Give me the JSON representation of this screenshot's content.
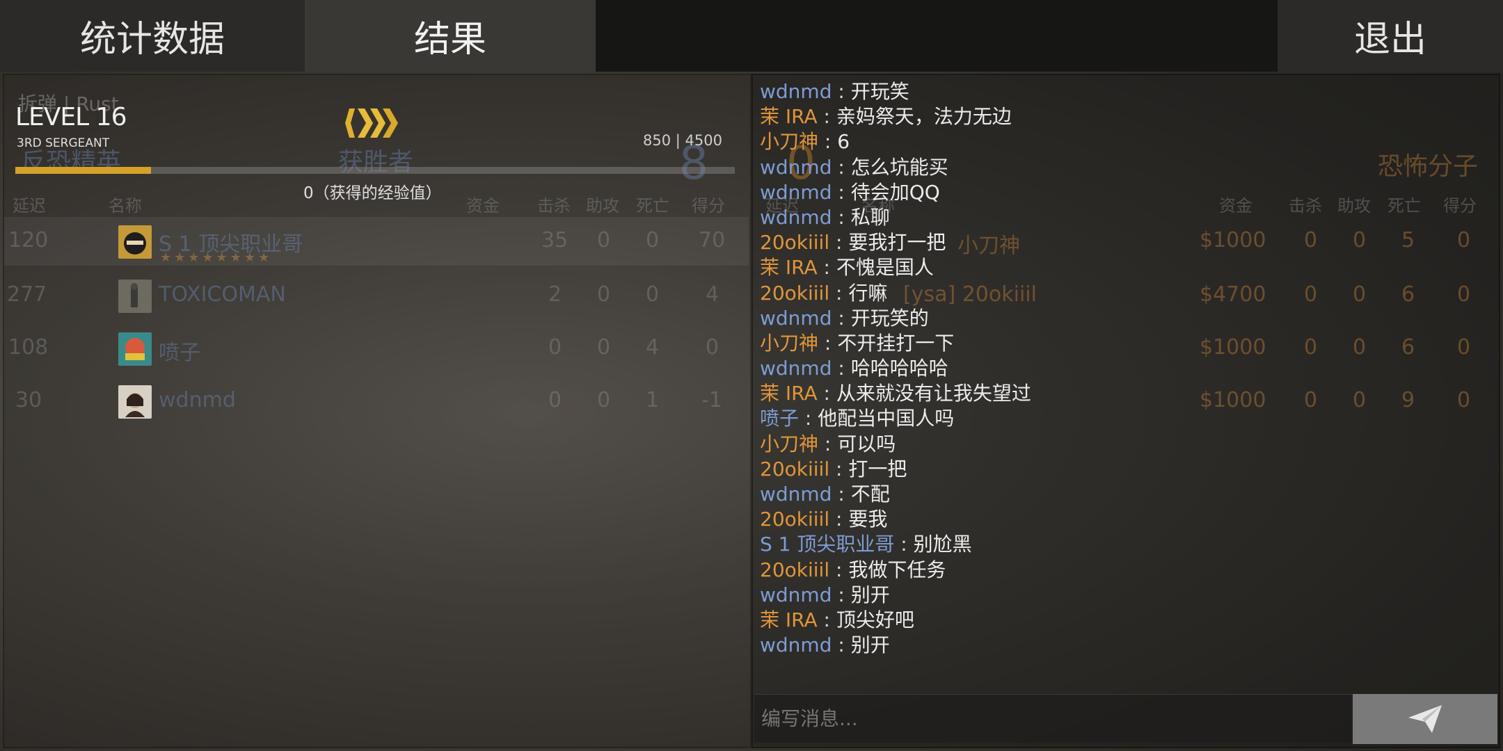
{
  "tabs": {
    "stats": "统计数据",
    "result": "结果",
    "exit": "退出"
  },
  "header": {
    "mode": "拆弹 | Rust",
    "team_ct": "反恐精英",
    "winner_label": "获胜者",
    "ct_score": "8",
    "t_score": "0",
    "team_t": "恐怖分子"
  },
  "progress": {
    "level": "LEVEL 16",
    "rank": "3RD SERGEANT",
    "xp_text": "850 | 4500",
    "xp_current": 850,
    "xp_total": 4500,
    "xp_earned": "0（获得的经验值）",
    "colors": {
      "fill": "#d6a128",
      "rank_icon": "#e0b030"
    }
  },
  "columns": {
    "ct": {
      "ping": "延迟",
      "name": "名称",
      "money": "资金",
      "kills": "击杀",
      "assists": "助攻",
      "deaths": "死亡",
      "score": "得分"
    },
    "t": {
      "ping": "延迟",
      "name": "名称",
      "money": "资金",
      "kills": "击杀",
      "assists": "助攻",
      "deaths": "死亡",
      "score": "得分"
    }
  },
  "ct_players": [
    {
      "ping": "120",
      "name": "S 1 顶尖职业哥",
      "stars": "★★★★★★★★",
      "kills": "35",
      "assists": "0",
      "deaths": "0",
      "score": "70",
      "avatar": "ninja-avatar"
    },
    {
      "ping": "277",
      "name": "TOXICOMAN",
      "kills": "2",
      "assists": "0",
      "deaths": "0",
      "score": "4",
      "avatar": "soldier-avatar"
    },
    {
      "ping": "108",
      "name": "喷子",
      "kills": "0",
      "assists": "0",
      "deaths": "4",
      "score": "0",
      "avatar": "colorful-avatar"
    },
    {
      "ping": "30",
      "name": "wdnmd",
      "kills": "0",
      "assists": "0",
      "deaths": "1",
      "score": "-1",
      "avatar": "girl-avatar"
    }
  ],
  "t_players": [
    {
      "name": "小刀神",
      "money": "$1000",
      "kills": "0",
      "assists": "0",
      "deaths": "5",
      "score": "0"
    },
    {
      "name": "[ysa] 20okiiil",
      "money": "$4700",
      "kills": "0",
      "assists": "0",
      "deaths": "6",
      "score": "0"
    },
    {
      "name": "",
      "money": "$1000",
      "kills": "0",
      "assists": "0",
      "deaths": "6",
      "score": "0"
    },
    {
      "name": "",
      "money": "$1000",
      "kills": "0",
      "assists": "0",
      "deaths": "9",
      "score": "0"
    }
  ],
  "chat": [
    {
      "author": "wdnmd",
      "team": "ct",
      "text": "开玩笑"
    },
    {
      "author": "茉 IRA",
      "team": "t",
      "text": "亲妈祭天，法力无边"
    },
    {
      "author": "小刀神",
      "team": "t",
      "text": "6"
    },
    {
      "author": "wdnmd",
      "team": "ct",
      "text": "怎么坑能买"
    },
    {
      "author": "wdnmd",
      "team": "ct",
      "text": "待会加QQ"
    },
    {
      "author": "wdnmd",
      "team": "ct",
      "text": "私聊"
    },
    {
      "author": "20okiiil",
      "team": "t",
      "text": "要我打一把"
    },
    {
      "author": "茉 IRA",
      "team": "t",
      "text": "不愧是国人"
    },
    {
      "author": "20okiiil",
      "team": "t",
      "text": "行嘛"
    },
    {
      "author": "wdnmd",
      "team": "ct",
      "text": "开玩笑的"
    },
    {
      "author": "小刀神",
      "team": "t",
      "text": "不开挂打一下"
    },
    {
      "author": "wdnmd",
      "team": "ct",
      "text": "哈哈哈哈哈"
    },
    {
      "author": "茉 IRA",
      "team": "t",
      "text": "从来就没有让我失望过"
    },
    {
      "author": "喷子",
      "team": "ct",
      "text": "他配当中国人吗"
    },
    {
      "author": "小刀神",
      "team": "t",
      "text": "可以吗"
    },
    {
      "author": "20okiiil",
      "team": "t",
      "text": "打一把"
    },
    {
      "author": "wdnmd",
      "team": "ct",
      "text": "不配"
    },
    {
      "author": "20okiiil",
      "team": "t",
      "text": "要我"
    },
    {
      "author": "S 1 顶尖职业哥",
      "team": "ct",
      "text": "别尬黑"
    },
    {
      "author": "20okiiil",
      "team": "t",
      "text": "我做下任务"
    },
    {
      "author": "wdnmd",
      "team": "ct",
      "text": "别开"
    },
    {
      "author": "茉 IRA",
      "team": "t",
      "text": "顶尖好吧"
    },
    {
      "author": "wdnmd",
      "team": "ct",
      "text": "别开"
    }
  ],
  "chat_input": {
    "placeholder": "编写消息..."
  },
  "icons": {
    "send": "send-icon",
    "rank": "rank-chevron-icon"
  }
}
